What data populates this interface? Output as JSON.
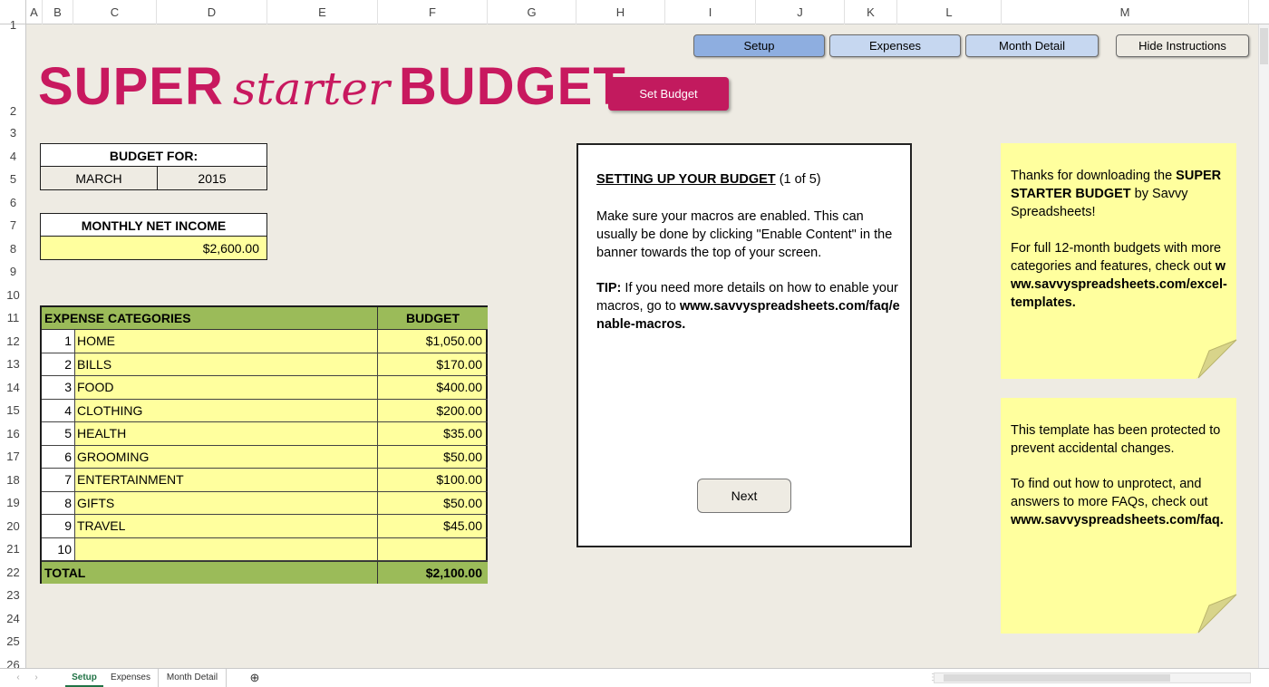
{
  "columns": [
    "A",
    "B",
    "C",
    "D",
    "E",
    "F",
    "G",
    "H",
    "I",
    "J",
    "K",
    "L",
    "M"
  ],
  "rows": [
    "1",
    "2",
    "3",
    "4",
    "5",
    "6",
    "7",
    "8",
    "9",
    "10",
    "11",
    "12",
    "13",
    "14",
    "15",
    "16",
    "17",
    "18",
    "19",
    "20",
    "21",
    "22",
    "23",
    "24",
    "25",
    "26"
  ],
  "nav": {
    "setup": "Setup",
    "expenses": "Expenses",
    "month_detail": "Month Detail",
    "hide_instructions": "Hide Instructions"
  },
  "title": {
    "part1": "SUPER",
    "part2": "starter",
    "part3": "BUDGET"
  },
  "set_budget": "Set Budget",
  "budget_for": {
    "label": "BUDGET FOR:",
    "month": "MARCH",
    "year": "2015"
  },
  "income": {
    "label": "MONTHLY NET INCOME",
    "value": "$2,600.00"
  },
  "expenses": {
    "header_category": "EXPENSE CATEGORIES",
    "header_budget": "BUDGET",
    "items": [
      {
        "num": "1",
        "name": "HOME",
        "value": "$1,050.00"
      },
      {
        "num": "2",
        "name": "BILLS",
        "value": "$170.00"
      },
      {
        "num": "3",
        "name": "FOOD",
        "value": "$400.00"
      },
      {
        "num": "4",
        "name": "CLOTHING",
        "value": "$200.00"
      },
      {
        "num": "5",
        "name": "HEALTH",
        "value": "$35.00"
      },
      {
        "num": "6",
        "name": "GROOMING",
        "value": "$50.00"
      },
      {
        "num": "7",
        "name": "ENTERTAINMENT",
        "value": "$100.00"
      },
      {
        "num": "8",
        "name": "GIFTS",
        "value": "$50.00"
      },
      {
        "num": "9",
        "name": "TRAVEL",
        "value": "$45.00"
      },
      {
        "num": "10",
        "name": "",
        "value": ""
      }
    ],
    "total_label": "TOTAL",
    "total_value": "$2,100.00"
  },
  "instructions": {
    "heading": "SETTING UP YOUR BUDGET",
    "step": "(1 of 5)",
    "para1": "Make sure your macros are enabled.  This can usually be done by clicking \"Enable Content\" in the banner towards the top of your screen.",
    "tip_label": "TIP:",
    "tip_text": "  If you need more details on how to enable your macros, go to",
    "tip_link": "www.savvyspreadsheets.com/faq/enable-macros.",
    "next": "Next"
  },
  "note1": {
    "line1_pre": "Thanks for downloading the ",
    "line1_bold": "SUPER STARTER BUDGET",
    "line1_post": " by Savvy Spreadsheets!",
    "para2": "For full 12-month budgets with more categories and features, check out",
    "link": "www.savvyspreadsheets.com/excel-templates."
  },
  "note2": {
    "para1": "This template has been protected to prevent accidental changes.",
    "para2": "To find out how to unprotect, and answers to more FAQs, check out",
    "link": "www.savvyspreadsheets.com/faq."
  },
  "sheets": [
    "Setup",
    "Expenses",
    "Month Detail"
  ],
  "colors": {
    "accent": "#C8195F",
    "cell_yellow": "#FFFF9E",
    "header_green": "#9BBB59",
    "button_blue": "#8EAEE0",
    "button_light": "#C6D7F0"
  }
}
